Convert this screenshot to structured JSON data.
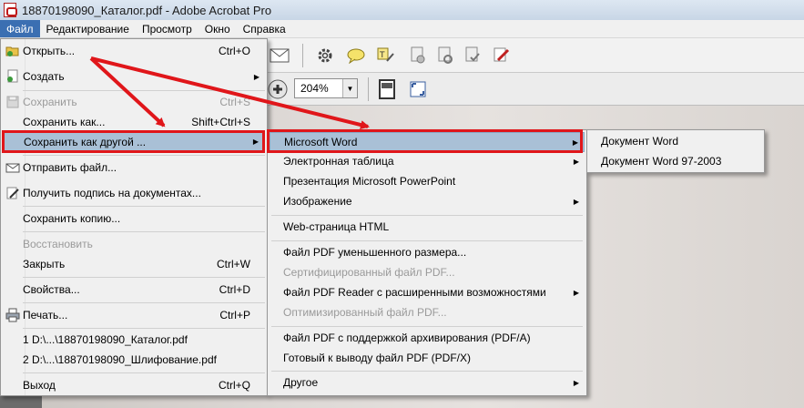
{
  "window": {
    "title": "18870198090_Каталог.pdf - Adobe Acrobat Pro"
  },
  "menubar": [
    {
      "label": "Файл",
      "active": true
    },
    {
      "label": "Редактирование"
    },
    {
      "label": "Просмотр"
    },
    {
      "label": "Окно"
    },
    {
      "label": "Справка"
    }
  ],
  "toolbar": {
    "zoom_value": "204%"
  },
  "file_menu": {
    "open": {
      "label": "Открыть...",
      "shortcut": "Ctrl+O",
      "icon": "open-folder-icon"
    },
    "create": {
      "label": "Создать"
    },
    "save": {
      "label": "Сохранить",
      "shortcut": "Ctrl+S"
    },
    "save_as": {
      "label": "Сохранить как...",
      "shortcut": "Shift+Ctrl+S"
    },
    "save_as_other": {
      "label": "Сохранить как другой ..."
    },
    "send_file": {
      "label": "Отправить файл...",
      "icon": "envelope-icon"
    },
    "get_signature": {
      "label": "Получить подпись на документах...",
      "icon": "sign-pen-icon"
    },
    "save_copy": {
      "label": "Сохранить копию..."
    },
    "restore": {
      "label": "Восстановить"
    },
    "close": {
      "label": "Закрыть",
      "shortcut": "Ctrl+W"
    },
    "properties": {
      "label": "Свойства...",
      "shortcut": "Ctrl+D"
    },
    "print": {
      "label": "Печать...",
      "shortcut": "Ctrl+P",
      "icon": "printer-icon"
    },
    "recent1": {
      "label": "1 D:\\...\\18870198090_Каталог.pdf"
    },
    "recent2": {
      "label": "2 D:\\...\\18870198090_Шлифование.pdf"
    },
    "exit": {
      "label": "Выход",
      "shortcut": "Ctrl+Q"
    }
  },
  "saveas_menu": {
    "word": "Microsoft Word",
    "spreadsheet": "Электронная таблица",
    "powerpoint": "Презентация Microsoft PowerPoint",
    "image": "Изображение",
    "html": "Web-страница HTML",
    "reduced": "Файл PDF уменьшенного размера...",
    "certified": "Сертифицированный файл PDF...",
    "reader_ext": "Файл PDF Reader с расширенными возможностями",
    "optimized": "Оптимизированный файл PDF...",
    "pdfa": "Файл PDF с поддержкой архивирования (PDF/A)",
    "pdfx": "Готовый к выводу файл PDF (PDF/X)",
    "other": "Другое"
  },
  "word_menu": {
    "docx": "Документ Word",
    "doc97": "Документ Word 97-2003"
  },
  "colors": {
    "highlight": "#a9c0d6",
    "annotation_red": "#e0161a",
    "menu_active": "#3b6fb2"
  }
}
